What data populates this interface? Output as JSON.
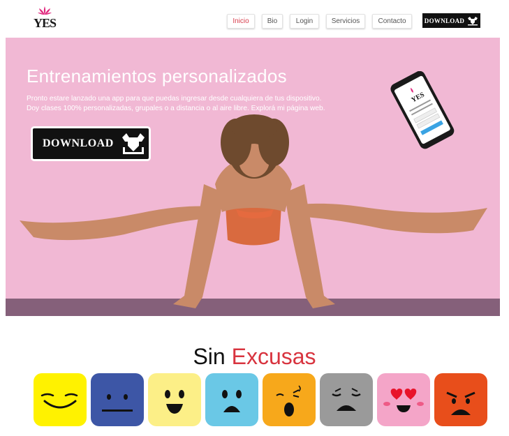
{
  "header": {
    "logo_text": "YES",
    "nav": [
      {
        "label": "Inicio",
        "active": true
      },
      {
        "label": "Bio",
        "active": false
      },
      {
        "label": "Login",
        "active": false
      },
      {
        "label": "Servicios",
        "active": false
      },
      {
        "label": "Contacto",
        "active": false
      }
    ],
    "download_label": "DOWNLOAD"
  },
  "hero": {
    "title": "Entrenamientos personalizados",
    "line1": "Pronto estare lanzado una app para que puedas ingresar desde cualquiera de tus dispositivo.",
    "line2": "Doy clases 100% personalizadas, grupales o a distancia o al aire libre. Explorá mi página web.",
    "download_label": "DOWNLOAD",
    "background_color": "#f1b8d4"
  },
  "section": {
    "title_word1": "Sin",
    "title_word2": "Excusas",
    "accent_color": "#d8343f"
  },
  "emojis": [
    {
      "name": "happy",
      "color": "#fff200"
    },
    {
      "name": "neutral",
      "color": "#3d56a6"
    },
    {
      "name": "smile",
      "color": "#fcef87"
    },
    {
      "name": "sad",
      "color": "#6ac8e6"
    },
    {
      "name": "surprised",
      "color": "#f7a81b"
    },
    {
      "name": "disappointed",
      "color": "#9a9a9a"
    },
    {
      "name": "love",
      "color": "#f4a5c8"
    },
    {
      "name": "angry",
      "color": "#e84e1b"
    }
  ]
}
